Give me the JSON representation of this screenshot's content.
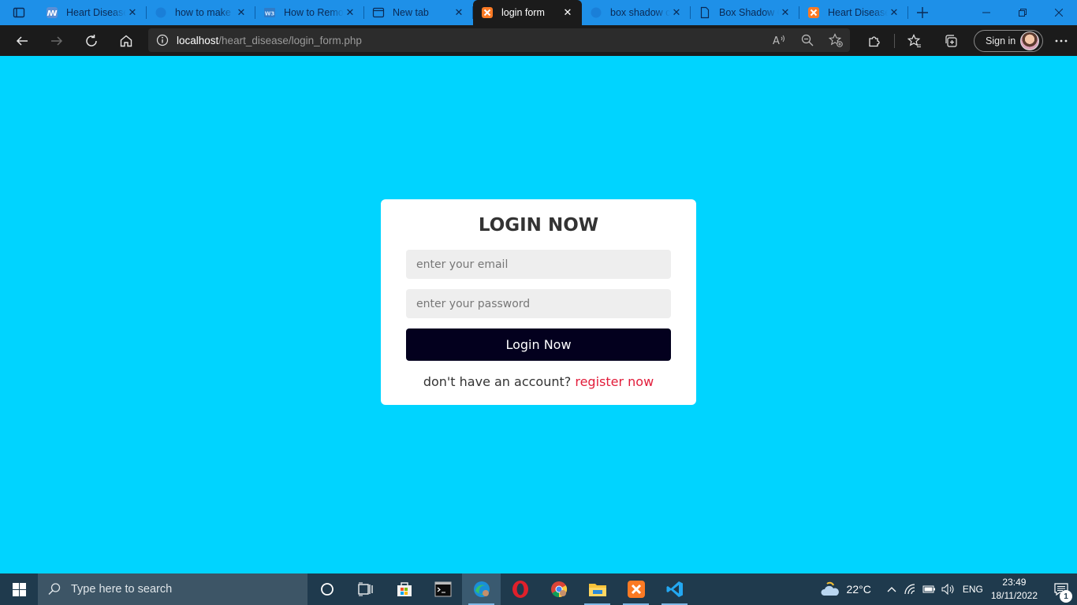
{
  "browser": {
    "tabs": [
      {
        "label": "Heart Disease",
        "icon": "xampp-icon",
        "active": false
      },
      {
        "label": "how to make",
        "icon": "edge-icon",
        "active": false
      },
      {
        "label": "How to Remo",
        "icon": "w3-icon",
        "active": false
      },
      {
        "label": "New tab",
        "icon": "newtab-icon",
        "active": false
      },
      {
        "label": "login form",
        "icon": "xampp-icon",
        "active": true
      },
      {
        "label": "box shadow c",
        "icon": "edge-icon",
        "active": false
      },
      {
        "label": "Box Shadow C",
        "icon": "page-icon",
        "active": false
      },
      {
        "label": "Heart Disease",
        "icon": "xampp-icon",
        "active": false
      }
    ],
    "url_host": "localhost",
    "url_path": "/heart_disease/login_form.php",
    "signin_label": "Sign in",
    "accent": "#1e90e8"
  },
  "login": {
    "title": "LOGIN NOW",
    "email_placeholder": "enter your email",
    "password_placeholder": "enter your password",
    "submit_label": "Login Now",
    "register_prompt": "don't have an account?",
    "register_link": "register now",
    "background_color": "#00d4ff",
    "button_color": "#03001e",
    "link_color": "#e21c3a"
  },
  "taskbar": {
    "search_placeholder": "Type here to search",
    "temperature": "22°C",
    "language": "ENG",
    "time": "23:49",
    "date": "18/11/2022",
    "notification_count": "1"
  }
}
